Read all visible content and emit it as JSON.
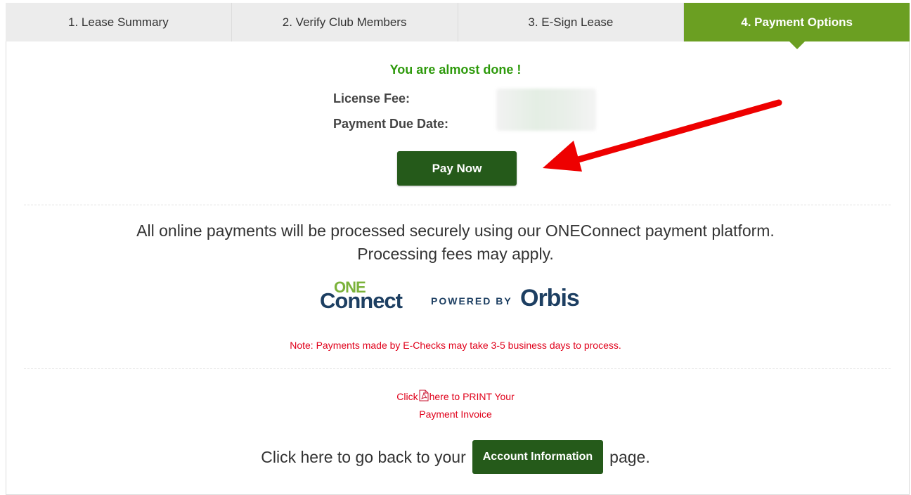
{
  "tabs": [
    {
      "label": "1. Lease Summary"
    },
    {
      "label": "2. Verify Club Members"
    },
    {
      "label": "3. E-Sign Lease"
    },
    {
      "label": "4. Payment Options"
    }
  ],
  "payment": {
    "heading": "You are almost done !",
    "license_fee_label": "License Fee:",
    "due_date_label": "Payment Due Date:",
    "pay_button": "Pay Now"
  },
  "info": {
    "line1": "All online payments will be processed securely using our ONEConnect payment platform.",
    "line2": "Processing fees may apply."
  },
  "logo": {
    "one": "ONE",
    "connect": "Connect",
    "powered_by": "POWERED BY",
    "orbis": "Orbis"
  },
  "note": "Note: Payments made by E-Checks may take 3-5 business days to process.",
  "print_invoice": {
    "click": "Click",
    "here_text": "here to PRINT Your",
    "line2": "Payment Invoice"
  },
  "back": {
    "prefix": "Click here to go back to your",
    "button": "Account Information",
    "suffix": "page."
  },
  "colors": {
    "active_tab": "#6b9f22",
    "button": "#255a1a",
    "heading_green": "#2e9a0c",
    "note_red": "#e0001a",
    "arrow_red": "#ee0000"
  }
}
